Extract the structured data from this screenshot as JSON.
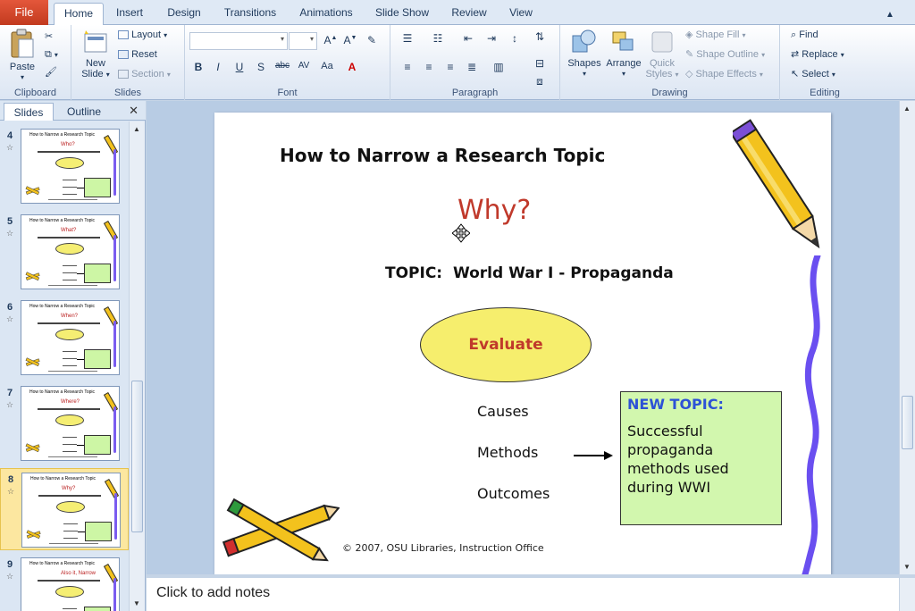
{
  "window": {
    "tabs": [
      {
        "label": "File"
      },
      {
        "label": "Home"
      },
      {
        "label": "Insert"
      },
      {
        "label": "Design"
      },
      {
        "label": "Transitions"
      },
      {
        "label": "Animations"
      },
      {
        "label": "Slide Show"
      },
      {
        "label": "Review"
      },
      {
        "label": "View"
      }
    ],
    "active_tab": "Home"
  },
  "ribbon": {
    "clipboard": {
      "label": "Clipboard",
      "paste": "Paste"
    },
    "slides": {
      "label": "Slides",
      "new_slide_line1": "New",
      "new_slide_line2": "Slide",
      "layout": "Layout",
      "reset": "Reset",
      "section": "Section"
    },
    "font": {
      "label": "Font"
    },
    "paragraph": {
      "label": "Paragraph"
    },
    "drawing": {
      "label": "Drawing",
      "shapes": "Shapes",
      "arrange": "Arrange",
      "quick_styles_line1": "Quick",
      "quick_styles_line2": "Styles",
      "shape_fill": "Shape Fill",
      "shape_outline": "Shape Outline",
      "shape_effects": "Shape Effects"
    },
    "editing": {
      "label": "Editing",
      "find": "Find",
      "replace": "Replace",
      "select": "Select"
    }
  },
  "left_panel": {
    "tabs": [
      {
        "label": "Slides"
      },
      {
        "label": "Outline"
      }
    ],
    "thumbnails": [
      {
        "number": "4",
        "question": "Who?",
        "title": "How to Narrow a Research Topic"
      },
      {
        "number": "5",
        "question": "What?",
        "title": "How to Narrow a Research Topic"
      },
      {
        "number": "6",
        "question": "When?",
        "title": "How to Narrow a Research Topic"
      },
      {
        "number": "7",
        "question": "Where?",
        "title": "How to Narrow a Research Topic"
      },
      {
        "number": "8",
        "question": "Why?",
        "title": "How to Narrow a Research Topic",
        "selected": true
      },
      {
        "number": "9",
        "question": "Also it, Narrow",
        "title": "How to Narrow a Research Topic"
      }
    ]
  },
  "slide": {
    "title": "How to Narrow a Research Topic",
    "question": "Why?",
    "topic_label": "TOPIC:",
    "topic_value": "World War I - Propaganda",
    "ellipse_text": "Evaluate",
    "items": [
      "Causes",
      "Methods",
      "Outcomes"
    ],
    "new_topic_heading": "NEW TOPIC:",
    "new_topic_body": "Successful propaganda methods used during WWI",
    "footer": "© 2007, OSU Libraries, Instruction Office"
  },
  "notes": {
    "placeholder": "Click to add notes"
  },
  "colors": {
    "accent": "#2d52d6",
    "question": "#c0392b",
    "box_fill": "#d2f7ae",
    "ellipse_fill": "#f6ee6d",
    "file_tab": "#d24726"
  }
}
